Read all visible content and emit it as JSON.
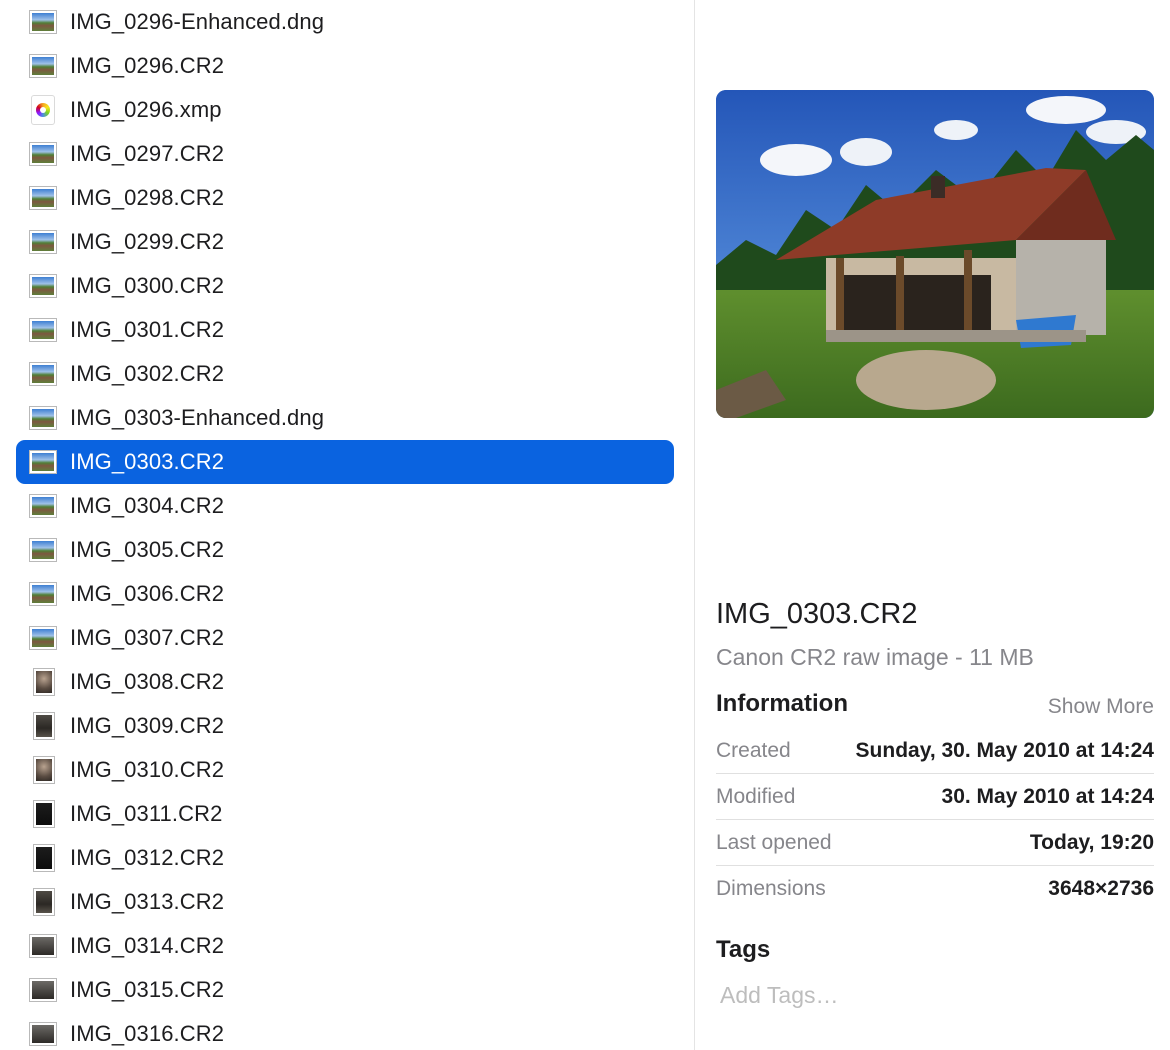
{
  "files": [
    {
      "name": "IMG_0296-Enhanced.dng",
      "thumb": "landscape",
      "selected": false
    },
    {
      "name": "IMG_0296.CR2",
      "thumb": "landscape",
      "selected": false
    },
    {
      "name": "IMG_0296.xmp",
      "thumb": "xmp",
      "selected": false
    },
    {
      "name": "IMG_0297.CR2",
      "thumb": "landscape",
      "selected": false
    },
    {
      "name": "IMG_0298.CR2",
      "thumb": "landscape",
      "selected": false
    },
    {
      "name": "IMG_0299.CR2",
      "thumb": "landscape",
      "selected": false
    },
    {
      "name": "IMG_0300.CR2",
      "thumb": "landscape",
      "selected": false
    },
    {
      "name": "IMG_0301.CR2",
      "thumb": "landscape",
      "selected": false
    },
    {
      "name": "IMG_0302.CR2",
      "thumb": "landscape",
      "selected": false
    },
    {
      "name": "IMG_0303-Enhanced.dng",
      "thumb": "landscape",
      "selected": false
    },
    {
      "name": "IMG_0303.CR2",
      "thumb": "landscape",
      "selected": true
    },
    {
      "name": "IMG_0304.CR2",
      "thumb": "landscape",
      "selected": false
    },
    {
      "name": "IMG_0305.CR2",
      "thumb": "landscape",
      "selected": false
    },
    {
      "name": "IMG_0306.CR2",
      "thumb": "landscape",
      "selected": false
    },
    {
      "name": "IMG_0307.CR2",
      "thumb": "landscape",
      "selected": false
    },
    {
      "name": "IMG_0308.CR2",
      "thumb": "portrait-interior",
      "selected": false
    },
    {
      "name": "IMG_0309.CR2",
      "thumb": "portrait-dark",
      "selected": false
    },
    {
      "name": "IMG_0310.CR2",
      "thumb": "portrait-interior",
      "selected": false
    },
    {
      "name": "IMG_0311.CR2",
      "thumb": "portrait-very-dark",
      "selected": false
    },
    {
      "name": "IMG_0312.CR2",
      "thumb": "portrait-very-dark",
      "selected": false
    },
    {
      "name": "IMG_0313.CR2",
      "thumb": "portrait-dark",
      "selected": false
    },
    {
      "name": "IMG_0314.CR2",
      "thumb": "room",
      "selected": false
    },
    {
      "name": "IMG_0315.CR2",
      "thumb": "room",
      "selected": false
    },
    {
      "name": "IMG_0316.CR2",
      "thumb": "room",
      "selected": false
    }
  ],
  "preview": {
    "title": "IMG_0303.CR2",
    "subtitle": "Canon CR2 raw image - 11 MB",
    "image_icon": "house-photo"
  },
  "information": {
    "heading": "Information",
    "show_more": "Show More",
    "rows": [
      {
        "label": "Created",
        "value": "Sunday, 30. May 2010 at 14:24"
      },
      {
        "label": "Modified",
        "value": "30. May 2010 at 14:24"
      },
      {
        "label": "Last opened",
        "value": "Today, 19:20"
      },
      {
        "label": "Dimensions",
        "value": "3648×2736"
      }
    ]
  },
  "tags": {
    "heading": "Tags",
    "placeholder": "Add Tags…"
  },
  "colors": {
    "selection": "#0a63e0",
    "secondary_text": "#86868b"
  }
}
